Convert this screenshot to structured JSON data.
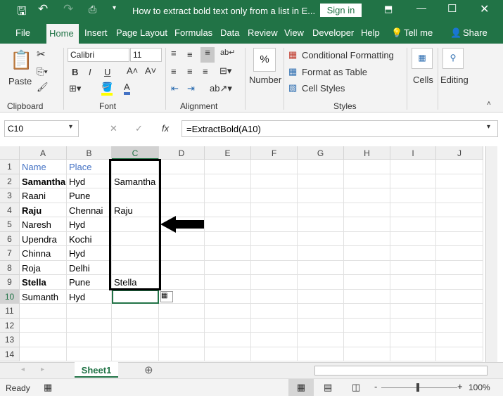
{
  "titlebar": {
    "title": "How to extract bold text only from a list in E...",
    "sign_in": "Sign in"
  },
  "tabs": [
    "File",
    "Home",
    "Insert",
    "Page Layout",
    "Formulas",
    "Data",
    "Review",
    "View",
    "Developer",
    "Help",
    "Tell me",
    "Share"
  ],
  "ribbon": {
    "paste": "Paste",
    "font_name": "Calibri",
    "font_size": "11",
    "bold": "B",
    "italic": "I",
    "underline": "U",
    "number": "Number",
    "number_icon": "%",
    "conditional_formatting": "Conditional Formatting",
    "format_as_table": "Format as Table",
    "cell_styles": "Cell Styles",
    "cells": "Cells",
    "editing": "Editing",
    "groups": {
      "clipboard": "Clipboard",
      "font": "Font",
      "alignment": "Alignment",
      "styles": "Styles"
    }
  },
  "formula_bar": {
    "name_box": "C10",
    "formula": "=ExtractBold(A10)",
    "fx": "fx"
  },
  "columns": [
    "A",
    "B",
    "C",
    "D",
    "E",
    "F",
    "G",
    "H",
    "I",
    "J"
  ],
  "rows": [
    {
      "n": "1",
      "A": "Name",
      "B": "Place",
      "C": "",
      "header": true
    },
    {
      "n": "2",
      "A": "Samantha",
      "B": "Hyd",
      "C": "Samantha",
      "bold": true
    },
    {
      "n": "3",
      "A": "Raani",
      "B": "Pune",
      "C": ""
    },
    {
      "n": "4",
      "A": "Raju",
      "B": "Chennai",
      "C": "Raju",
      "bold": true
    },
    {
      "n": "5",
      "A": "Naresh",
      "B": "Hyd",
      "C": ""
    },
    {
      "n": "6",
      "A": "Upendra",
      "B": "Kochi",
      "C": ""
    },
    {
      "n": "7",
      "A": "Chinna",
      "B": "Hyd",
      "C": ""
    },
    {
      "n": "8",
      "A": "Roja",
      "B": "Delhi",
      "C": ""
    },
    {
      "n": "9",
      "A": "Stella",
      "B": "Pune",
      "C": "Stella",
      "bold": true
    },
    {
      "n": "10",
      "A": "Sumanth",
      "B": "Hyd",
      "C": ""
    },
    {
      "n": "11"
    },
    {
      "n": "12"
    },
    {
      "n": "13"
    },
    {
      "n": "14"
    }
  ],
  "selected_cell": "C10",
  "sheet_tab": "Sheet1",
  "status": {
    "ready": "Ready",
    "zoom": "100%"
  },
  "colors": {
    "brand": "#217346",
    "header_text": "#4472c4"
  }
}
